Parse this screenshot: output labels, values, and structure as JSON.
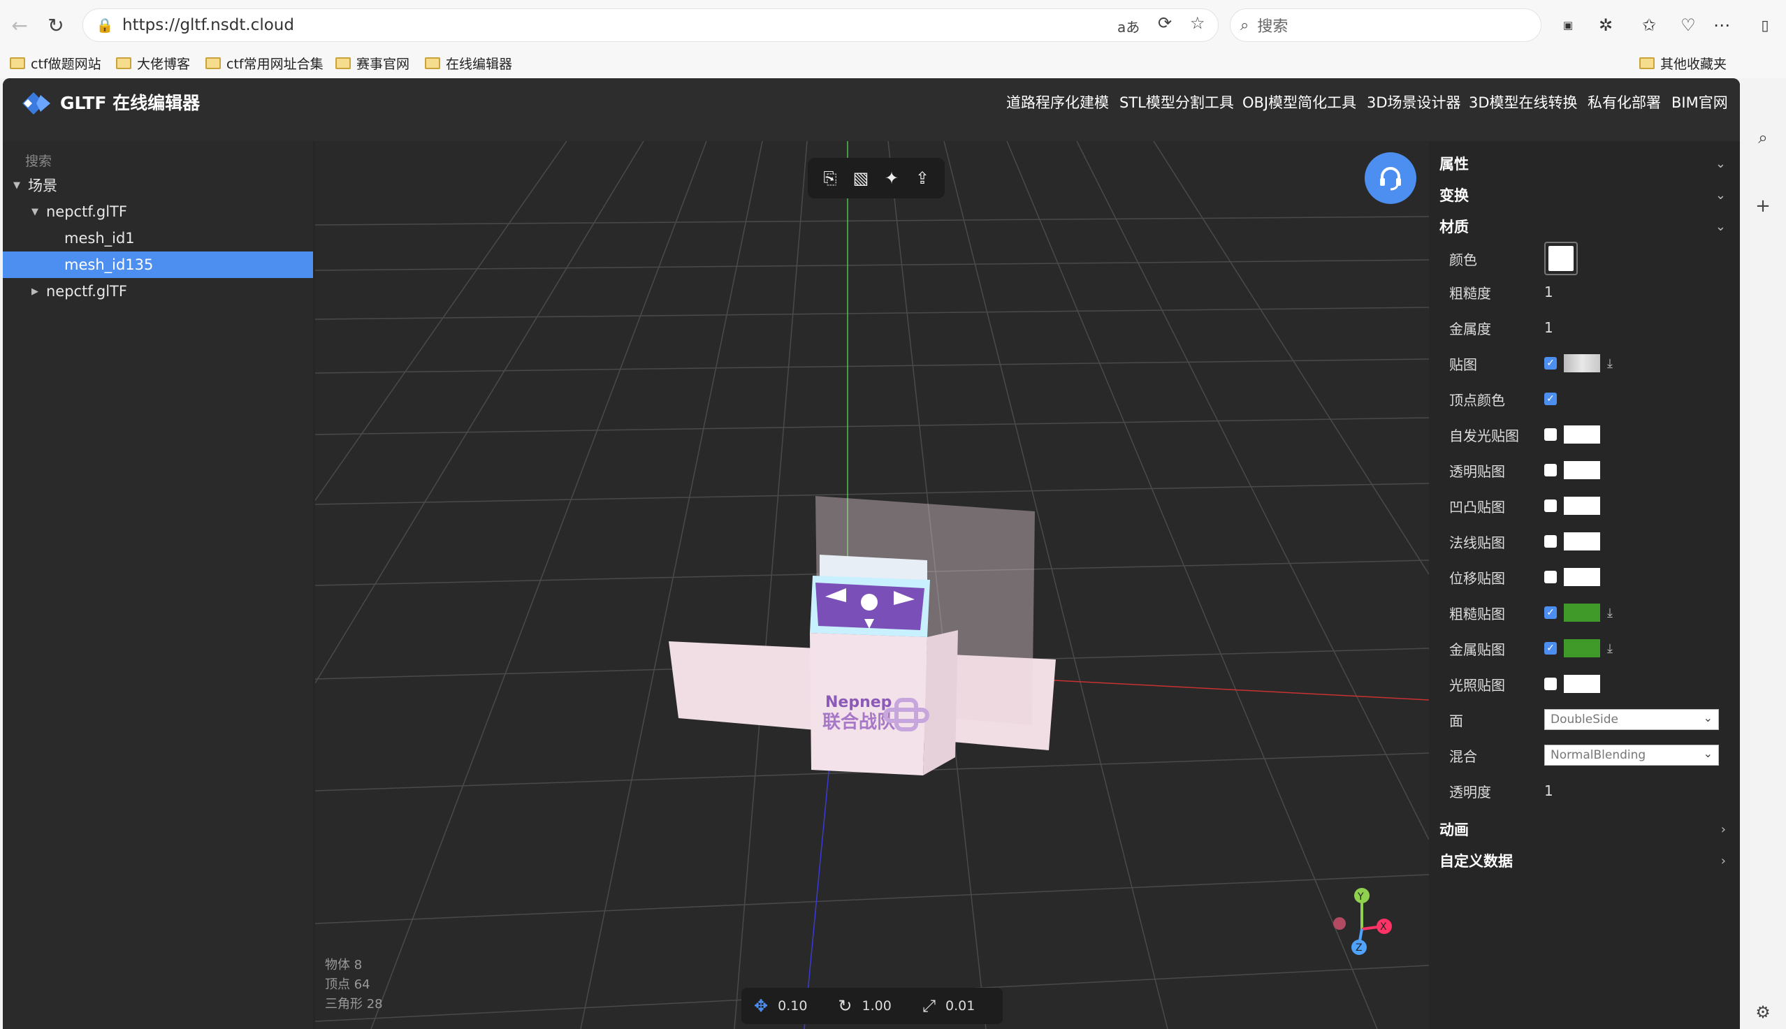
{
  "browser": {
    "url": "https://gltf.nsdt.cloud",
    "search_placeholder": "搜索",
    "translate_glyph": "aあ",
    "bookmarks": [
      "ctf做题网站",
      "大佬博客",
      "ctf常用网址合集",
      "赛事官网",
      "在线编辑器"
    ],
    "other_bookmarks": "其他收藏夹"
  },
  "app": {
    "title": "GLTF 在线编辑器",
    "nav": [
      "道路程序化建模",
      "STL模型分割工具",
      "OBJ模型简化工具",
      "3D场景设计器",
      "3D模型在线转换",
      "私有化部署",
      "BIM官网"
    ]
  },
  "tree": {
    "search_label": "搜索",
    "root": "场景",
    "items": [
      {
        "label": "nepctf.glTF",
        "level": 1,
        "expanded": true
      },
      {
        "label": "mesh_id1",
        "level": 2
      },
      {
        "label": "mesh_id135",
        "level": 2,
        "selected": true
      },
      {
        "label": "nepctf.glTF",
        "level": 1,
        "expanded": false
      }
    ]
  },
  "viewport": {
    "stats": {
      "objects": "物体 8",
      "vertices": "顶点 64",
      "triangles": "三角形 28"
    },
    "bottom": {
      "translate": "0.10",
      "rotate": "1.00",
      "scale": "0.01"
    },
    "gizmo": {
      "x": "X",
      "y": "Y",
      "z": "Z"
    },
    "texture": {
      "brand": "Nepnep",
      "team": "联合战队"
    }
  },
  "props": {
    "sections": {
      "attributes": "属性",
      "transform": "变换",
      "material": "材质",
      "animation": "动画",
      "custom": "自定义数据"
    },
    "rows": {
      "color": "颜色",
      "roughness": "粗糙度",
      "roughness_value": "1",
      "metalness": "金属度",
      "metalness_value": "1",
      "map": "贴图",
      "vertex_colors": "顶点颜色",
      "emissive_map": "自发光贴图",
      "alpha_map": "透明贴图",
      "bump_map": "凹凸贴图",
      "normal_map": "法线贴图",
      "displacement_map": "位移贴图",
      "roughness_map": "粗糙贴图",
      "metalness_map": "金属贴图",
      "light_map": "光照贴图",
      "side": "面",
      "side_value": "DoubleSide",
      "blending": "混合",
      "blending_value": "NormalBlending",
      "opacity": "透明度",
      "opacity_value": "1"
    }
  },
  "colors": {
    "accent": "#4d8ff0",
    "map_green": "#3f9a2a"
  }
}
